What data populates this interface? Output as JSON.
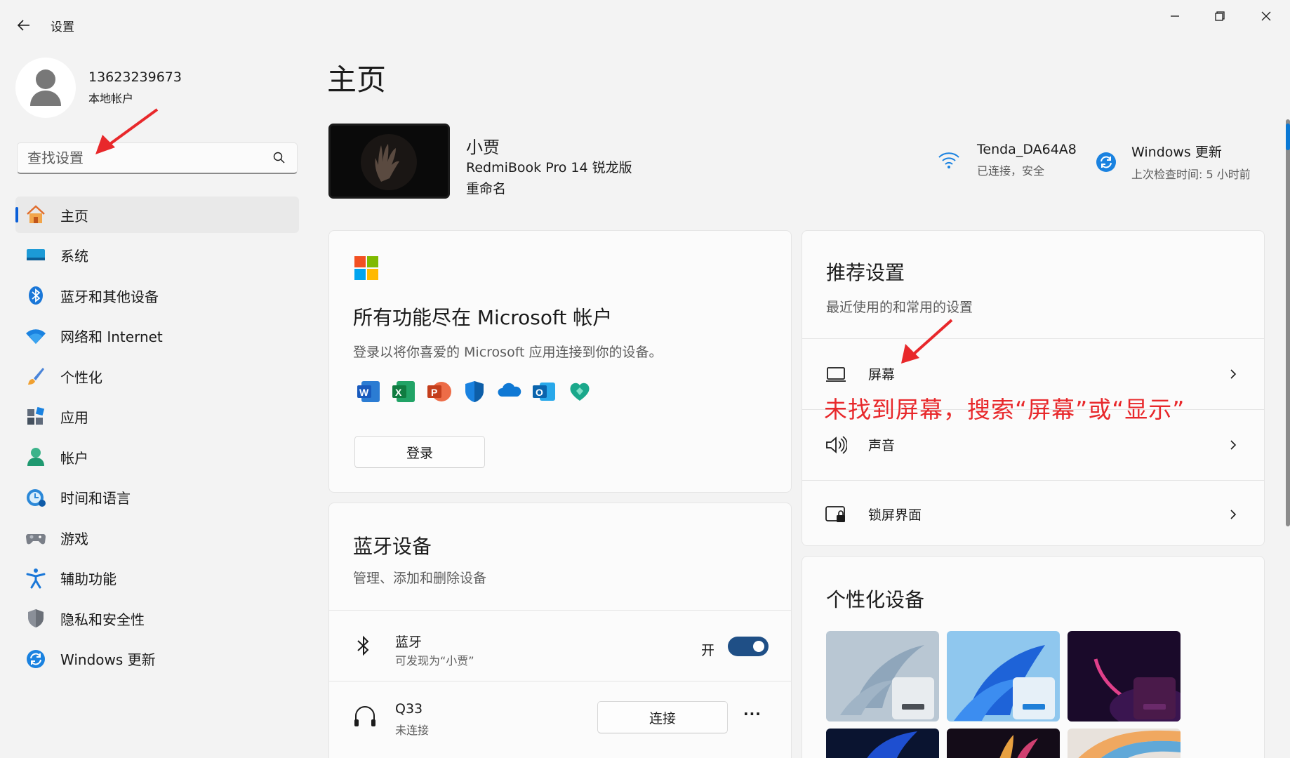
{
  "window": {
    "title": "设置",
    "controls": [
      "minimize",
      "maximize",
      "close"
    ]
  },
  "profile": {
    "name": "13623239673",
    "account_type": "本地帐户"
  },
  "search": {
    "placeholder": "查找设置"
  },
  "sidebar": {
    "items": [
      {
        "label": "主页",
        "icon": "home-icon",
        "active": true
      },
      {
        "label": "系统",
        "icon": "system-icon",
        "active": false
      },
      {
        "label": "蓝牙和其他设备",
        "icon": "bluetooth-icon",
        "active": false
      },
      {
        "label": "网络和 Internet",
        "icon": "wifi-icon",
        "active": false
      },
      {
        "label": "个性化",
        "icon": "brush-icon",
        "active": false
      },
      {
        "label": "应用",
        "icon": "apps-icon",
        "active": false
      },
      {
        "label": "帐户",
        "icon": "account-icon",
        "active": false
      },
      {
        "label": "时间和语言",
        "icon": "time-language-icon",
        "active": false
      },
      {
        "label": "游戏",
        "icon": "gamepad-icon",
        "active": false
      },
      {
        "label": "辅助功能",
        "icon": "accessibility-icon",
        "active": false
      },
      {
        "label": "隐私和安全性",
        "icon": "shield-icon",
        "active": false
      },
      {
        "label": "Windows 更新",
        "icon": "windows-update-icon",
        "active": false
      }
    ]
  },
  "main": {
    "page_title": "主页",
    "device": {
      "name": "小贾",
      "model": "RedmiBook Pro 14 锐龙版",
      "rename_label": "重命名"
    },
    "network": {
      "name": "Tenda_DA64A8",
      "status": "已连接，安全"
    },
    "update": {
      "title": "Windows 更新",
      "status": "上次检查时间: 5 小时前"
    },
    "microsoft_card": {
      "title": "所有功能尽在 Microsoft 帐户",
      "description": "登录以将你喜爱的 Microsoft 应用连接到你的设备。",
      "apps": [
        "word-icon",
        "excel-icon",
        "powerpoint-icon",
        "defender-icon",
        "onedrive-icon",
        "outlook-icon",
        "family-icon"
      ],
      "signin_label": "登录"
    },
    "bluetooth_card": {
      "title": "蓝牙设备",
      "subtitle": "管理、添加和删除设备",
      "bluetooth_row": {
        "label": "蓝牙",
        "sub": "可发现为“小贾”",
        "state_label": "开",
        "on": true
      },
      "device_row": {
        "label": "Q33",
        "sub": "未连接",
        "connect_label": "连接",
        "more_label": "···"
      }
    },
    "recommended_card": {
      "title": "推荐设置",
      "subtitle": "最近使用的和常用的设置",
      "items": [
        {
          "label": "屏幕",
          "icon": "display-icon"
        },
        {
          "label": "声音",
          "icon": "speaker-icon"
        },
        {
          "label": "锁屏界面",
          "icon": "lockscreen-icon"
        }
      ]
    },
    "personalize_card": {
      "title": "个性化设备"
    }
  },
  "annotation": {
    "text": "未找到屏幕，搜索“屏幕”或“显示”",
    "color": "#e8282b"
  },
  "colors": {
    "accent": "#0a5fd8",
    "toggle_on": "#1f4f86",
    "background": "#f3f3f3",
    "card": "#fbfbfb"
  }
}
